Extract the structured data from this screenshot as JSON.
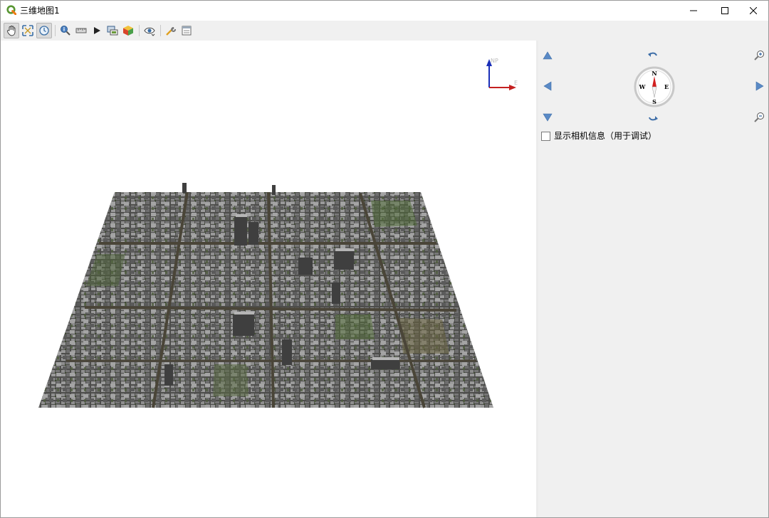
{
  "window": {
    "title": "三维地图1",
    "controls": [
      "minimize",
      "maximize",
      "close"
    ]
  },
  "toolbar": {
    "tools": [
      {
        "name": "pan-icon",
        "active": true
      },
      {
        "name": "zoom-full-icon",
        "active": false
      },
      {
        "name": "camera-orbit-icon",
        "active": true
      },
      {
        "name": "identify-icon",
        "active": false
      },
      {
        "name": "measure-icon",
        "active": false
      },
      {
        "name": "animation-play-icon",
        "active": false
      },
      {
        "name": "save-image-icon",
        "active": false
      },
      {
        "name": "export-3d-icon",
        "active": false
      },
      {
        "name": "view-options-icon",
        "active": false
      },
      {
        "name": "configure-icon",
        "active": false
      },
      {
        "name": "map-themes-icon",
        "active": false
      }
    ]
  },
  "canvas": {
    "axes": {
      "z_label": "N",
      "y_label": "P",
      "x_label": "E"
    },
    "colors": {
      "background": "#ffffff",
      "buildings": "#5c5c5c",
      "roads": "#4a4538",
      "vegetation": "#4e5e3c"
    }
  },
  "navigation": {
    "compass": {
      "north": "N",
      "south": "S",
      "east": "E",
      "west": "W"
    },
    "buttons": [
      "move-up",
      "rotate-up",
      "zoom-in",
      "move-left",
      "move-right",
      "move-down",
      "rotate-down",
      "zoom-out"
    ],
    "camera_info": {
      "label": "显示相机信息（用于调试）",
      "checked": false
    }
  }
}
